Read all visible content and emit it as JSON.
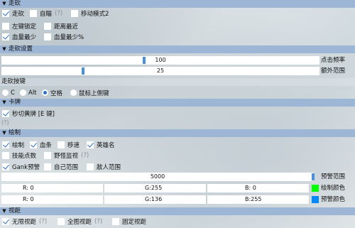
{
  "sections": {
    "walk": "走砍",
    "walk_settings": "走砍设置",
    "walk_key": "走砍按键",
    "card": "卡牌",
    "draw": "绘制",
    "vision": "视距"
  },
  "walk": {
    "walk_label": "走砍",
    "aim_label": "自瞄",
    "aim_help": "(?)",
    "move_mode_label": "移动模式2"
  },
  "walk2": {
    "left_lock_label": "左键锁定",
    "nearest_label": "距离最近",
    "least_hp_label": "血量最少",
    "least_hp_pct_label": "血量最少%"
  },
  "walk_settings": {
    "click_freq_value": "100",
    "click_freq_label": "点击频率",
    "extra_range_value": "25",
    "extra_range_label": "额外范围"
  },
  "walk_key": {
    "options": [
      "C",
      "Alt",
      "空格",
      "鼠标上侧键"
    ],
    "selected": "空格"
  },
  "card": {
    "instant_yellow_label": "秒切黄牌 [E 键]",
    "help": "(?)"
  },
  "draw": {
    "draw_label": "绘制",
    "blood_label": "血条",
    "move_label": "移速",
    "hero_name_label": "英雄名",
    "skill_cd_label": "技能点数",
    "jungle_label": "野怪监视",
    "jungle_help": "(?)",
    "gank_label": "Gank预警",
    "self_range_label": "自己范围",
    "enemy_range_label": "敌人范围",
    "warn_range_value": "5000",
    "warn_range_label": "预警范围",
    "draw_color": {
      "r": "R:  0",
      "g": "G:255",
      "b": "B:  0",
      "label": "绘制颜色",
      "hex": "#00ff00"
    },
    "warn_color": {
      "r": "R:  0",
      "g": "G:136",
      "b": "B:255",
      "label": "预警颜色",
      "hex": "#0088ff"
    }
  },
  "vision": {
    "unlimited_label": "无限视距",
    "unlimited_help": "(?)",
    "global_label": "全图视距",
    "global_help": "(?)",
    "fixed_label": "固定视距"
  },
  "colors": {
    "header_bg": "#9db6d6",
    "accent": "#2a72c9",
    "slider_knob": "#4a90e0"
  }
}
